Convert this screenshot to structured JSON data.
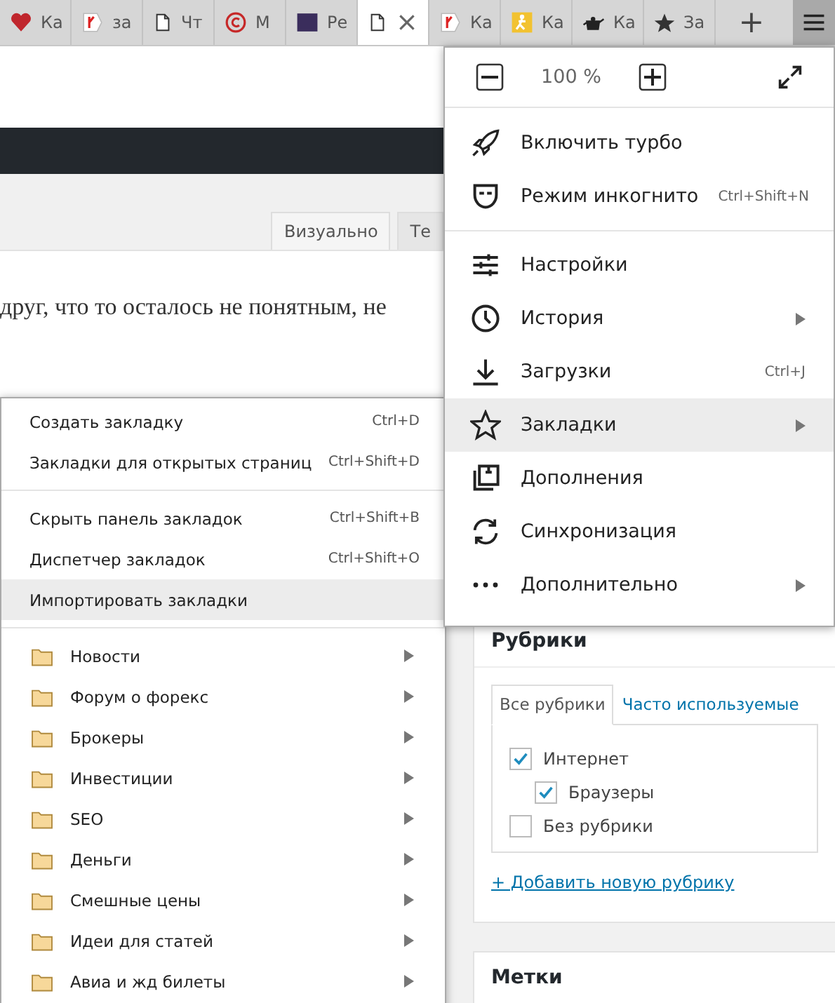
{
  "browser_tabs": [
    {
      "kind": "heart",
      "label": "Ка",
      "selected": false
    },
    {
      "kind": "yandex",
      "label": "за",
      "selected": false
    },
    {
      "kind": "page",
      "label": "Чт",
      "selected": false
    },
    {
      "kind": "copyright",
      "label": "М",
      "selected": false
    },
    {
      "kind": "fr",
      "label": "Ре",
      "selected": false
    },
    {
      "kind": "page",
      "close": "×",
      "selected": true
    },
    {
      "kind": "yandex",
      "label": "Ка",
      "selected": false
    },
    {
      "kind": "figure",
      "label": "Ка",
      "selected": false
    },
    {
      "kind": "teapot",
      "label": "Ка",
      "selected": false
    },
    {
      "kind": "star",
      "label": "За",
      "selected": false
    }
  ],
  "new_tab_button": "+",
  "editor": {
    "tabs": [
      {
        "label": "Визуально",
        "selected": true
      },
      {
        "label": "Те",
        "selected": false
      }
    ],
    "text": "друг, что то осталось не понятным, не"
  },
  "categories_panel": {
    "title": "Рубрики",
    "tabs": [
      {
        "label": "Все рубрики",
        "selected": true
      },
      {
        "label": "Часто используемые",
        "selected": false
      }
    ],
    "items": [
      {
        "label": "Интернет",
        "checked": true,
        "children": [
          {
            "label": "Браузеры",
            "checked": true
          }
        ]
      },
      {
        "label": "Без рубрики",
        "checked": false
      }
    ],
    "add_link": "+ Добавить новую рубрику"
  },
  "tags_panel": {
    "title": "Метки"
  },
  "main_menu": {
    "zoom": "100 %",
    "groups": [
      [
        {
          "kind": "turbo",
          "label": "Включить турбо",
          "selected": false
        },
        {
          "kind": "incognito",
          "label": "Режим инкогнито",
          "shortcut": "Ctrl+Shift+N",
          "selected": false
        }
      ],
      [
        {
          "kind": "settings",
          "label": "Настройки",
          "selected": false
        },
        {
          "kind": "history",
          "label": "История",
          "submenu": true,
          "selected": false
        },
        {
          "kind": "downloads",
          "label": "Загрузки",
          "shortcut": "Ctrl+J",
          "selected": false
        },
        {
          "kind": "bookmarks",
          "label": "Закладки",
          "submenu": true,
          "selected": true
        },
        {
          "kind": "addons",
          "label": "Дополнения",
          "selected": false
        },
        {
          "kind": "sync",
          "label": "Синхронизация",
          "selected": false
        },
        {
          "kind": "more",
          "label": "Дополнительно",
          "submenu": true,
          "selected": false
        }
      ]
    ]
  },
  "bookmarks_menu": {
    "groups": [
      [
        {
          "label": "Создать закладку",
          "shortcut": "Ctrl+D",
          "selected": false
        },
        {
          "label": "Закладки для открытых страниц",
          "shortcut": "Ctrl+Shift+D",
          "selected": false
        }
      ],
      [
        {
          "label": "Скрыть панель закладок",
          "shortcut": "Ctrl+Shift+B",
          "selected": false
        },
        {
          "label": "Диспетчер закладок",
          "shortcut": "Ctrl+Shift+O",
          "selected": false
        },
        {
          "label": "Импортировать закладки",
          "selected": true
        }
      ]
    ],
    "folders": [
      {
        "label": "Новости"
      },
      {
        "label": "Форум о форекс"
      },
      {
        "label": "Брокеры"
      },
      {
        "label": "Инвестиции"
      },
      {
        "label": "SEO"
      },
      {
        "label": "Деньги"
      },
      {
        "label": "Смешные цены"
      },
      {
        "label": "Идеи для статей"
      },
      {
        "label": "Авиа и жд билеты"
      }
    ]
  }
}
